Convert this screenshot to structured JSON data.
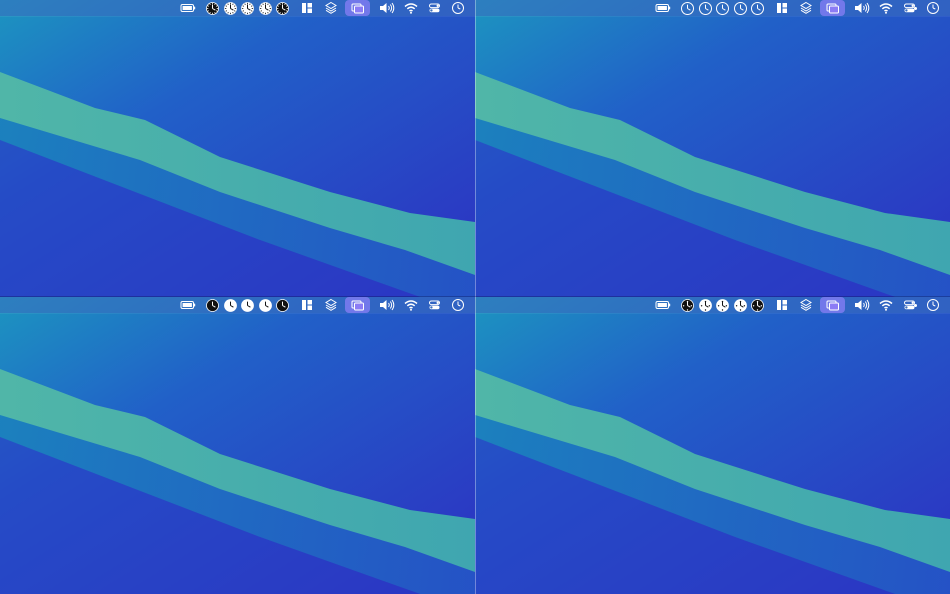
{
  "colors": {
    "wallpaper_teal": "#1a8fb8",
    "wallpaper_blue": "#2d3fc7",
    "ribbon": "#4fb3a6",
    "menubar": "#3c6ebe",
    "active_item": "#9a86ff"
  },
  "quadrants": [
    {
      "id": "top-left",
      "clock_style": "dark-filled-with-ticks",
      "clock_faces": [
        "dark",
        "light",
        "light",
        "light",
        "dark"
      ]
    },
    {
      "id": "top-right",
      "clock_style": "outline",
      "clock_faces": [
        "outline-dark",
        "outline-light",
        "outline-light",
        "outline-light",
        "outline-dark"
      ]
    },
    {
      "id": "bottom-left",
      "clock_style": "minimal",
      "clock_faces": [
        "dark",
        "light",
        "light",
        "light",
        "dark"
      ]
    },
    {
      "id": "bottom-right",
      "clock_style": "numerals",
      "clock_faces": [
        "dark",
        "light",
        "light",
        "light",
        "dark"
      ]
    }
  ],
  "menubar_icons": [
    "battery-icon",
    "world-clock-icons",
    "window-layout-icon",
    "layers-icon",
    "screens-icon",
    "volume-icon",
    "wifi-icon",
    "control-center-icon",
    "clock-icon"
  ]
}
